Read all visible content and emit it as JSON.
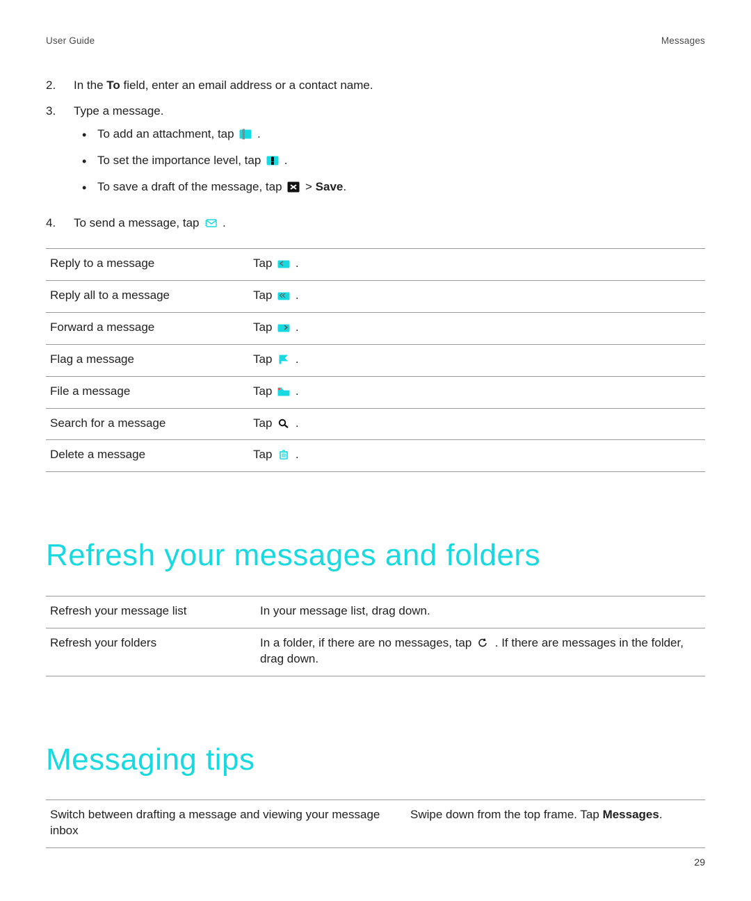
{
  "header": {
    "left": "User Guide",
    "right": "Messages"
  },
  "steps": [
    {
      "num": "2.",
      "parts": [
        "In the ",
        "To",
        " field, enter an email address or a contact name."
      ]
    },
    {
      "num": "3.",
      "parts": [
        "Type a message."
      ],
      "bullets": [
        {
          "pre": "To add an attachment, tap ",
          "post": " ."
        },
        {
          "pre": "To set the importance level, tap ",
          "post": " ."
        },
        {
          "pre": "To save a draft of the message, tap ",
          "mid": "  > ",
          "bold": "Save",
          "post": "."
        }
      ]
    },
    {
      "num": "4.",
      "parts": [
        "To send a message, tap ",
        " ."
      ]
    }
  ],
  "actions": [
    {
      "label": "Reply to a message",
      "pre": "Tap ",
      "post": " ."
    },
    {
      "label": "Reply all to a message",
      "pre": "Tap ",
      "post": " ."
    },
    {
      "label": "Forward a message",
      "pre": "Tap ",
      "post": " ."
    },
    {
      "label": "Flag a message",
      "pre": "Tap ",
      "post": " ."
    },
    {
      "label": "File a message",
      "pre": "Tap ",
      "post": " ."
    },
    {
      "label": "Search for a message",
      "pre": "Tap ",
      "post": " ."
    },
    {
      "label": "Delete a message",
      "pre": "Tap ",
      "post": " ."
    }
  ],
  "sections": [
    {
      "heading": "Refresh your messages and folders"
    },
    {
      "heading": "Messaging tips"
    }
  ],
  "refresh": [
    {
      "label": "Refresh your message list",
      "desc": "In your message list, drag down."
    },
    {
      "label": "Refresh your folders",
      "pre": "In a folder, if there are no messages, tap ",
      "post": " . If there are messages in the folder, drag down."
    }
  ],
  "tips": [
    {
      "label": "Switch between drafting a message and viewing your message inbox",
      "pre": "Swipe down from the top frame. Tap ",
      "bold": "Messages",
      "post": "."
    }
  ],
  "page_number": "29",
  "colors": {
    "accent": "#18d9df",
    "text": "#222",
    "rule": "#999"
  }
}
